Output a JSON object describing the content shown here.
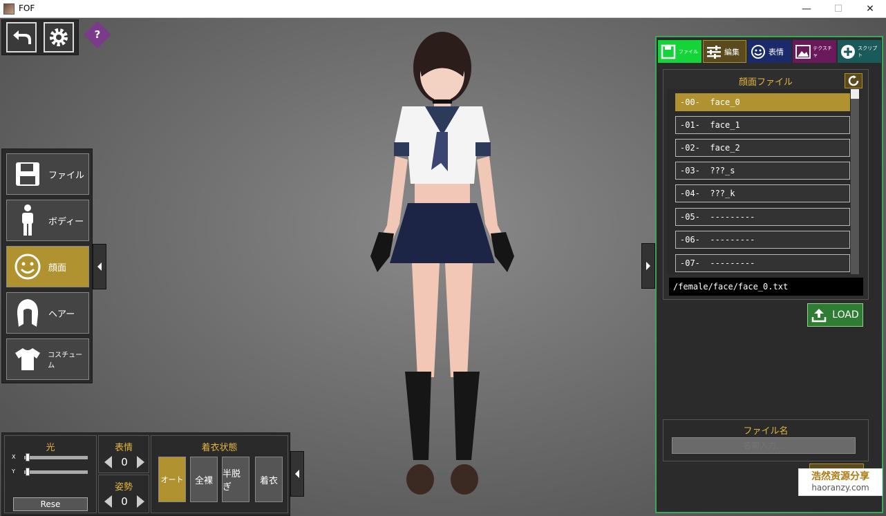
{
  "window": {
    "title": "FOF",
    "minimize": "—",
    "maximize": "☐",
    "close": "✕"
  },
  "top_toolbar": {
    "help_label": "?"
  },
  "left_menu": {
    "items": [
      {
        "label": "ファイル",
        "icon": "floppy-icon",
        "active": false
      },
      {
        "label": "ボディー",
        "icon": "body-icon",
        "active": false
      },
      {
        "label": "顔面",
        "icon": "smiley-icon",
        "active": true
      },
      {
        "label": "ヘアー",
        "icon": "hair-icon",
        "active": false
      },
      {
        "label": "コスチューム",
        "icon": "shirt-icon",
        "active": false
      }
    ]
  },
  "light": {
    "title": "光",
    "x_label": "X",
    "y_label": "Y",
    "x_value": 0.05,
    "y_value": 0.05,
    "reset_label": "Rese"
  },
  "expression": {
    "title": "表情",
    "value": "0"
  },
  "pose": {
    "title": "姿勢",
    "value": "0"
  },
  "clothing_state": {
    "title": "着衣状態",
    "options": [
      "オート",
      "全裸",
      "半脱ぎ",
      "着衣"
    ],
    "selected": "オート"
  },
  "right_panel": {
    "tabs": [
      {
        "label": "ファイル",
        "icon": "floppy-icon",
        "color": "#14d43a"
      },
      {
        "label": "編集",
        "icon": "sliders-icon",
        "color": "#5a4a1e"
      },
      {
        "label": "表情",
        "icon": "smiley-icon",
        "color": "#1a2a6a"
      },
      {
        "label": "テクスチャ",
        "icon": "image-icon",
        "color": "#6a1a5a"
      },
      {
        "label": "スクリプト",
        "icon": "plus-circle-icon",
        "color": "#1a5a5a"
      }
    ],
    "face_file": {
      "title": "顔面ファイル",
      "files": [
        {
          "index": "-00-",
          "name": "face_0",
          "selected": true
        },
        {
          "index": "-01-",
          "name": "face_1",
          "selected": false
        },
        {
          "index": "-02-",
          "name": "face_2",
          "selected": false
        },
        {
          "index": "-03-",
          "name": "???_s",
          "selected": false
        },
        {
          "index": "-04-",
          "name": "???_k",
          "selected": false
        },
        {
          "index": "-05-",
          "name": "---------",
          "selected": false
        },
        {
          "index": "-06-",
          "name": "---------",
          "selected": false
        },
        {
          "index": "-07-",
          "name": "---------",
          "selected": false
        }
      ],
      "path": "/female/face/face_0.txt",
      "load_label": "LOAD"
    },
    "filename": {
      "title": "ファイル名",
      "placeholder": "名前入力..."
    }
  },
  "watermark": {
    "line1": "浩然资源分享",
    "line2": "haoranzy.com"
  },
  "colors": {
    "accent_gold": "#b09330",
    "header_gold": "#e2b63d",
    "panel_border_green": "#39a85a",
    "load_green": "#2e7d32"
  }
}
